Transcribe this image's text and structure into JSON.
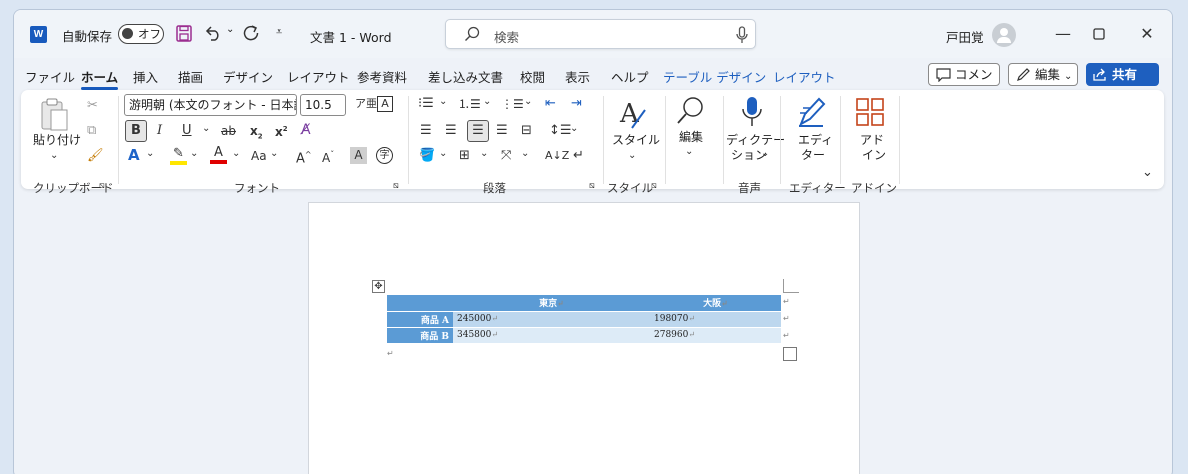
{
  "titlebar": {
    "logo_letter": "W",
    "autosave_label": "自動保存",
    "autosave_state": "オフ",
    "doc_title": "文書 1  -  Word",
    "search_placeholder": "検索",
    "user_name": "戸田覚"
  },
  "menu": {
    "items": [
      "ファイル",
      "ホーム",
      "挿入",
      "描画",
      "デザイン",
      "レイアウト",
      "参考資料",
      "差し込み文書",
      "校閲",
      "表示",
      "ヘルプ"
    ],
    "context_items": [
      "テーブル デザイン",
      "レイアウト"
    ],
    "active": "ホーム",
    "comment_label": "コメント",
    "edit_label": "編集",
    "share_label": "共有"
  },
  "ribbon": {
    "clipboard": {
      "paste_label": "貼り付け",
      "group_label": "クリップボード"
    },
    "font": {
      "font_name": "游明朝 (本文のフォント - 日本語)",
      "font_size": "10.5",
      "group_label": "フォント"
    },
    "paragraph": {
      "group_label": "段落"
    },
    "styles": {
      "label": "スタイル",
      "group_label": "スタイル"
    },
    "editing": {
      "label": "編集"
    },
    "voice": {
      "label1": "ディクテー",
      "label2": "ション",
      "group_label": "音声"
    },
    "editor": {
      "label1": "エディ",
      "label2": "ター",
      "group_label": "エディター"
    },
    "addins": {
      "label1": "アド",
      "label2": "イン",
      "group_label": "アドイン"
    }
  },
  "document": {
    "table": {
      "headers": [
        "",
        "東京",
        "大阪"
      ],
      "rows": [
        [
          "商品 A",
          "245000",
          "198070"
        ],
        [
          "商品 B",
          "345800",
          "278960"
        ]
      ]
    }
  },
  "colors": {
    "accent": "#185abd",
    "table_header": "#5b9bd5",
    "table_band1": "#bdd7ee",
    "table_band2": "#ddebf7"
  }
}
